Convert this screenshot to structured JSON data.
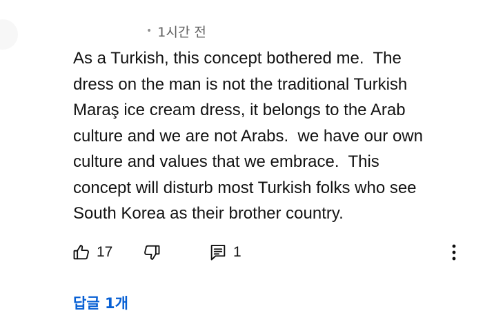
{
  "comment": {
    "timestamp": "1시간 전",
    "text": "As a Turkish, this concept bothered me.  The dress on the man is not the traditional Turkish Maraş ice cream dress, it belongs to the Arab culture and we are not Arabs.  we have our own culture and values that we embrace.  This concept will disturb most Turkish folks who see South Korea as their brother country.",
    "lines": [
      "As a Turkish, this concept bothered me.  The",
      "dress on the man is not the traditional Turkish",
      "Maraş ice cream dress, it belongs to the Arab",
      "culture and we are not Arabs.  we have our own",
      "culture and values that we embrace.  This",
      "concept will disturb most Turkish folks who see",
      "South Korea as their brother country."
    ]
  },
  "actions": {
    "like_icon": "thumbs-up-icon",
    "like_count": "17",
    "dislike_icon": "thumbs-down-icon",
    "reply_icon": "comment-icon",
    "reply_count": "1",
    "more_icon": "more-vertical-icon"
  },
  "replies": {
    "label": "답글 1개",
    "color": "#065fd4"
  }
}
